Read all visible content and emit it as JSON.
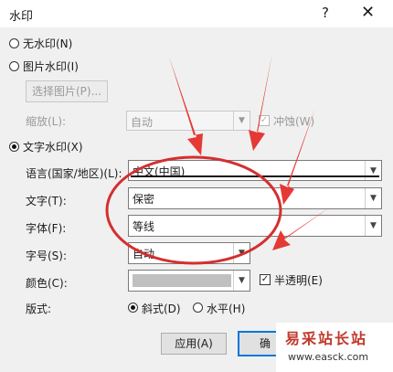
{
  "window": {
    "title": "水印",
    "help": "?",
    "close": "✕"
  },
  "no_watermark": {
    "label": "无水印(N)",
    "checked": false
  },
  "picture_watermark": {
    "label": "图片水印(I)",
    "checked": false,
    "select_button": "选择图片(P)...",
    "scale_label": "缩放(L):",
    "scale_value": "自动",
    "washout_label": "冲蚀(W)",
    "washout_checked": true
  },
  "text_watermark": {
    "label": "文字水印(X)",
    "checked": true,
    "language_label": "语言(国家/地区)(L):",
    "language_value": "中文(中国)",
    "text_label": "文字(T):",
    "text_value": "保密",
    "font_label": "字体(F):",
    "font_value": "等线",
    "size_label": "字号(S):",
    "size_value": "自动",
    "color_label": "颜色(C):",
    "color_value": "#c0c0c0",
    "semi_transparent_label": "半透明(E)",
    "semi_transparent_checked": true,
    "layout_label": "版式:",
    "diagonal_label": "斜式(D)",
    "diagonal_checked": true,
    "horizontal_label": "水平(H)",
    "horizontal_checked": false
  },
  "buttons": {
    "apply": "应用(A)",
    "ok": "确"
  },
  "overlay": {
    "logo": "易采站长站",
    "url": "www.easck.com",
    "arrow_color": "#e53935",
    "ellipse_color": "#d32f2f"
  }
}
